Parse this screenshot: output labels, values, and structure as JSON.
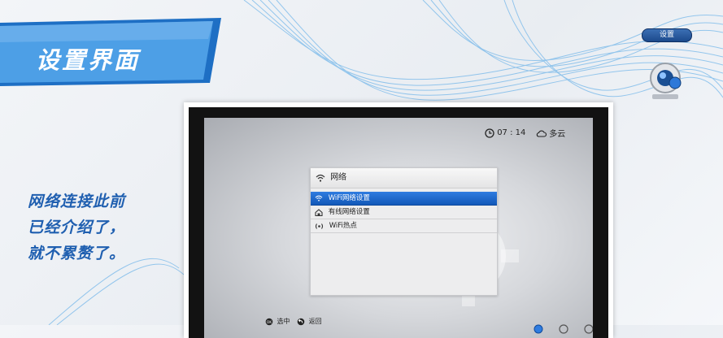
{
  "banner": {
    "title": "设置界面"
  },
  "settings": {
    "label": "设置"
  },
  "caption": {
    "lines": [
      "网络连接此前",
      "已经介绍了，",
      "就不累赘了。"
    ]
  },
  "status": {
    "time": "07 : 14",
    "weather": "多云"
  },
  "menu": {
    "title": "网络",
    "items": [
      {
        "label": "WiFi网络设置",
        "icon": "wifi-icon",
        "selected": true
      },
      {
        "label": "有线网络设置",
        "icon": "home-network-icon",
        "selected": false
      },
      {
        "label": "WiFi热点",
        "icon": "hotspot-icon",
        "selected": false
      }
    ]
  },
  "hints": {
    "ok": "选中",
    "back": "返回"
  },
  "colors": {
    "accent": "#1f5fb0",
    "selected": "#1a66cc",
    "banner": "#4a9be0"
  }
}
